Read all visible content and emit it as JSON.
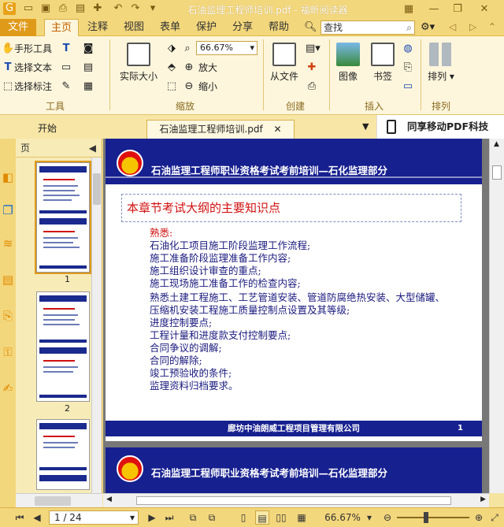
{
  "window": {
    "title": "石油监理工程师培训.pdf - 福昕阅读器"
  },
  "menu": {
    "file": "文件",
    "tabs": [
      "主页",
      "注释",
      "视图",
      "表单",
      "保护",
      "分享",
      "帮助"
    ],
    "search_placeholder": "查找"
  },
  "ribbon": {
    "hand_tool": "手形工具",
    "select_text": "选择文本",
    "select_annotation": "选择标注",
    "actual_size": "实际大小",
    "zoom_value": "66.67%",
    "zoom_in": "放大",
    "zoom_out": "缩小",
    "from_file": "从文件",
    "image": "图像",
    "bookmark": "书签",
    "arrange": "排列",
    "groups": {
      "tools": "工具",
      "zoom": "缩放",
      "create": "创建",
      "insert": "插入",
      "arrange": "排列"
    }
  },
  "doc_tabs": {
    "start": "开始",
    "current": "石油监理工程师培训.pdf",
    "mobile": "同享移动PDF科技"
  },
  "panel": {
    "header": "页",
    "pages": [
      "1",
      "2"
    ]
  },
  "slide": {
    "header_title": "石油监理工程师职业资格考试考前培训—石化监理部分",
    "box_title": "本章节考试大纲的主要知识点",
    "lead": "熟悉:",
    "lines": [
      "石油化工项目施工阶段监理工作流程;",
      "施工准备阶段监理准备工作内容;",
      "施工组织设计审查的重点;",
      "施工现场施工准备工作的检查内容;",
      "熟悉土建工程施工、工艺管道安装、管道防腐绝热安装、大型储罐、",
      "压缩机安装工程施工质量控制点设置及其等级;",
      "进度控制要点;",
      "工程计量和进度款支付控制要点;",
      "合同争议的调解;",
      "合同的解除;",
      "竣工预验收的条件;",
      "监理资料归档要求。"
    ],
    "footer_company": "廊坊中油朗威工程项目管理有限公司",
    "footer_page": "1",
    "next_header_title": "石油监理工程师职业资格考试考前培训—石化监理部分"
  },
  "status": {
    "page_input": "1 / 24",
    "zoom": "66.67%"
  },
  "colors": {
    "slide_blue": "#17208f",
    "accent_orange": "#e09a1a",
    "title_red": "#d01010"
  }
}
